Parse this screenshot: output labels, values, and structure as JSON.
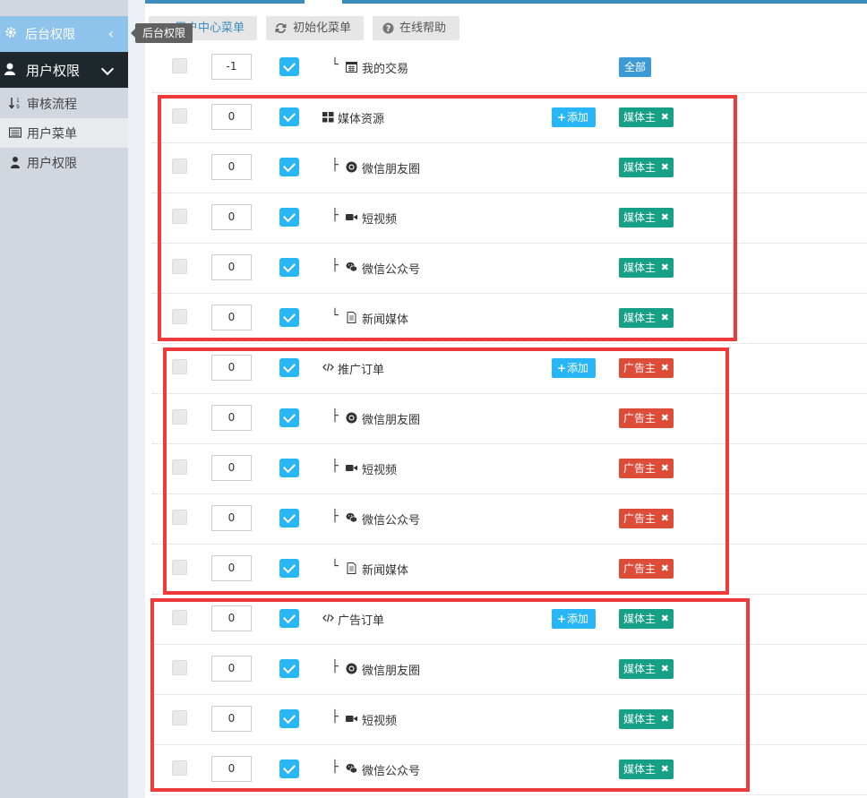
{
  "sidebar": {
    "header_label": "后台权限",
    "active_label": "用户权限",
    "items": [
      {
        "label": "审核流程",
        "icon": "sort-numeric-icon"
      },
      {
        "label": "用户菜单",
        "icon": "list-icon"
      },
      {
        "label": "用户权限",
        "icon": "user-icon"
      }
    ]
  },
  "tooltip": "后台权限",
  "toolbar": {
    "menu_btn": "用户中心菜单",
    "init_btn": "初始化菜单",
    "help_btn": "在线帮助"
  },
  "labels": {
    "add": "添加"
  },
  "rows": [
    {
      "order": "-1",
      "tree": "└",
      "icon": "calendar-icon",
      "name": "我的交易",
      "tag": "全部",
      "tag_kind": "all",
      "add": false
    },
    {
      "order": "0",
      "tree": "",
      "icon": "grid-icon",
      "name": "媒体资源",
      "tag": "媒体主",
      "tag_kind": "media",
      "add": true
    },
    {
      "order": "0",
      "tree": "├",
      "icon": "chrome-icon",
      "name": "微信朋友圈",
      "tag": "媒体主",
      "tag_kind": "media",
      "add": false
    },
    {
      "order": "0",
      "tree": "├",
      "icon": "video-icon",
      "name": "短视频",
      "tag": "媒体主",
      "tag_kind": "media",
      "add": false
    },
    {
      "order": "0",
      "tree": "├",
      "icon": "wechat-icon",
      "name": "微信公众号",
      "tag": "媒体主",
      "tag_kind": "media",
      "add": false
    },
    {
      "order": "0",
      "tree": "└",
      "icon": "file-icon",
      "name": "新闻媒体",
      "tag": "媒体主",
      "tag_kind": "media",
      "add": false
    },
    {
      "order": "0",
      "tree": "",
      "icon": "code-icon",
      "name": "推广订单",
      "tag": "广告主",
      "tag_kind": "ad",
      "add": true
    },
    {
      "order": "0",
      "tree": "├",
      "icon": "chrome-icon",
      "name": "微信朋友圈",
      "tag": "广告主",
      "tag_kind": "ad",
      "add": false
    },
    {
      "order": "0",
      "tree": "├",
      "icon": "video-icon",
      "name": "短视频",
      "tag": "广告主",
      "tag_kind": "ad",
      "add": false
    },
    {
      "order": "0",
      "tree": "├",
      "icon": "wechat-icon",
      "name": "微信公众号",
      "tag": "广告主",
      "tag_kind": "ad",
      "add": false
    },
    {
      "order": "0",
      "tree": "└",
      "icon": "file-icon",
      "name": "新闻媒体",
      "tag": "广告主",
      "tag_kind": "ad",
      "add": false
    },
    {
      "order": "0",
      "tree": "",
      "icon": "code-icon",
      "name": "广告订单",
      "tag": "媒体主",
      "tag_kind": "media",
      "add": true
    },
    {
      "order": "0",
      "tree": "├",
      "icon": "chrome-icon",
      "name": "微信朋友圈",
      "tag": "媒体主",
      "tag_kind": "media",
      "add": false
    },
    {
      "order": "0",
      "tree": "├",
      "icon": "video-icon",
      "name": "短视频",
      "tag": "媒体主",
      "tag_kind": "media",
      "add": false
    },
    {
      "order": "0",
      "tree": "├",
      "icon": "wechat-icon",
      "name": "微信公众号",
      "tag": "媒体主",
      "tag_kind": "media",
      "add": false
    }
  ],
  "colors": {
    "accent": "#29b6f6",
    "media_tag": "#16a085",
    "ad_tag": "#dd4b39",
    "all_tag": "#3c9ad6",
    "highlight": "#ee3a3a"
  }
}
